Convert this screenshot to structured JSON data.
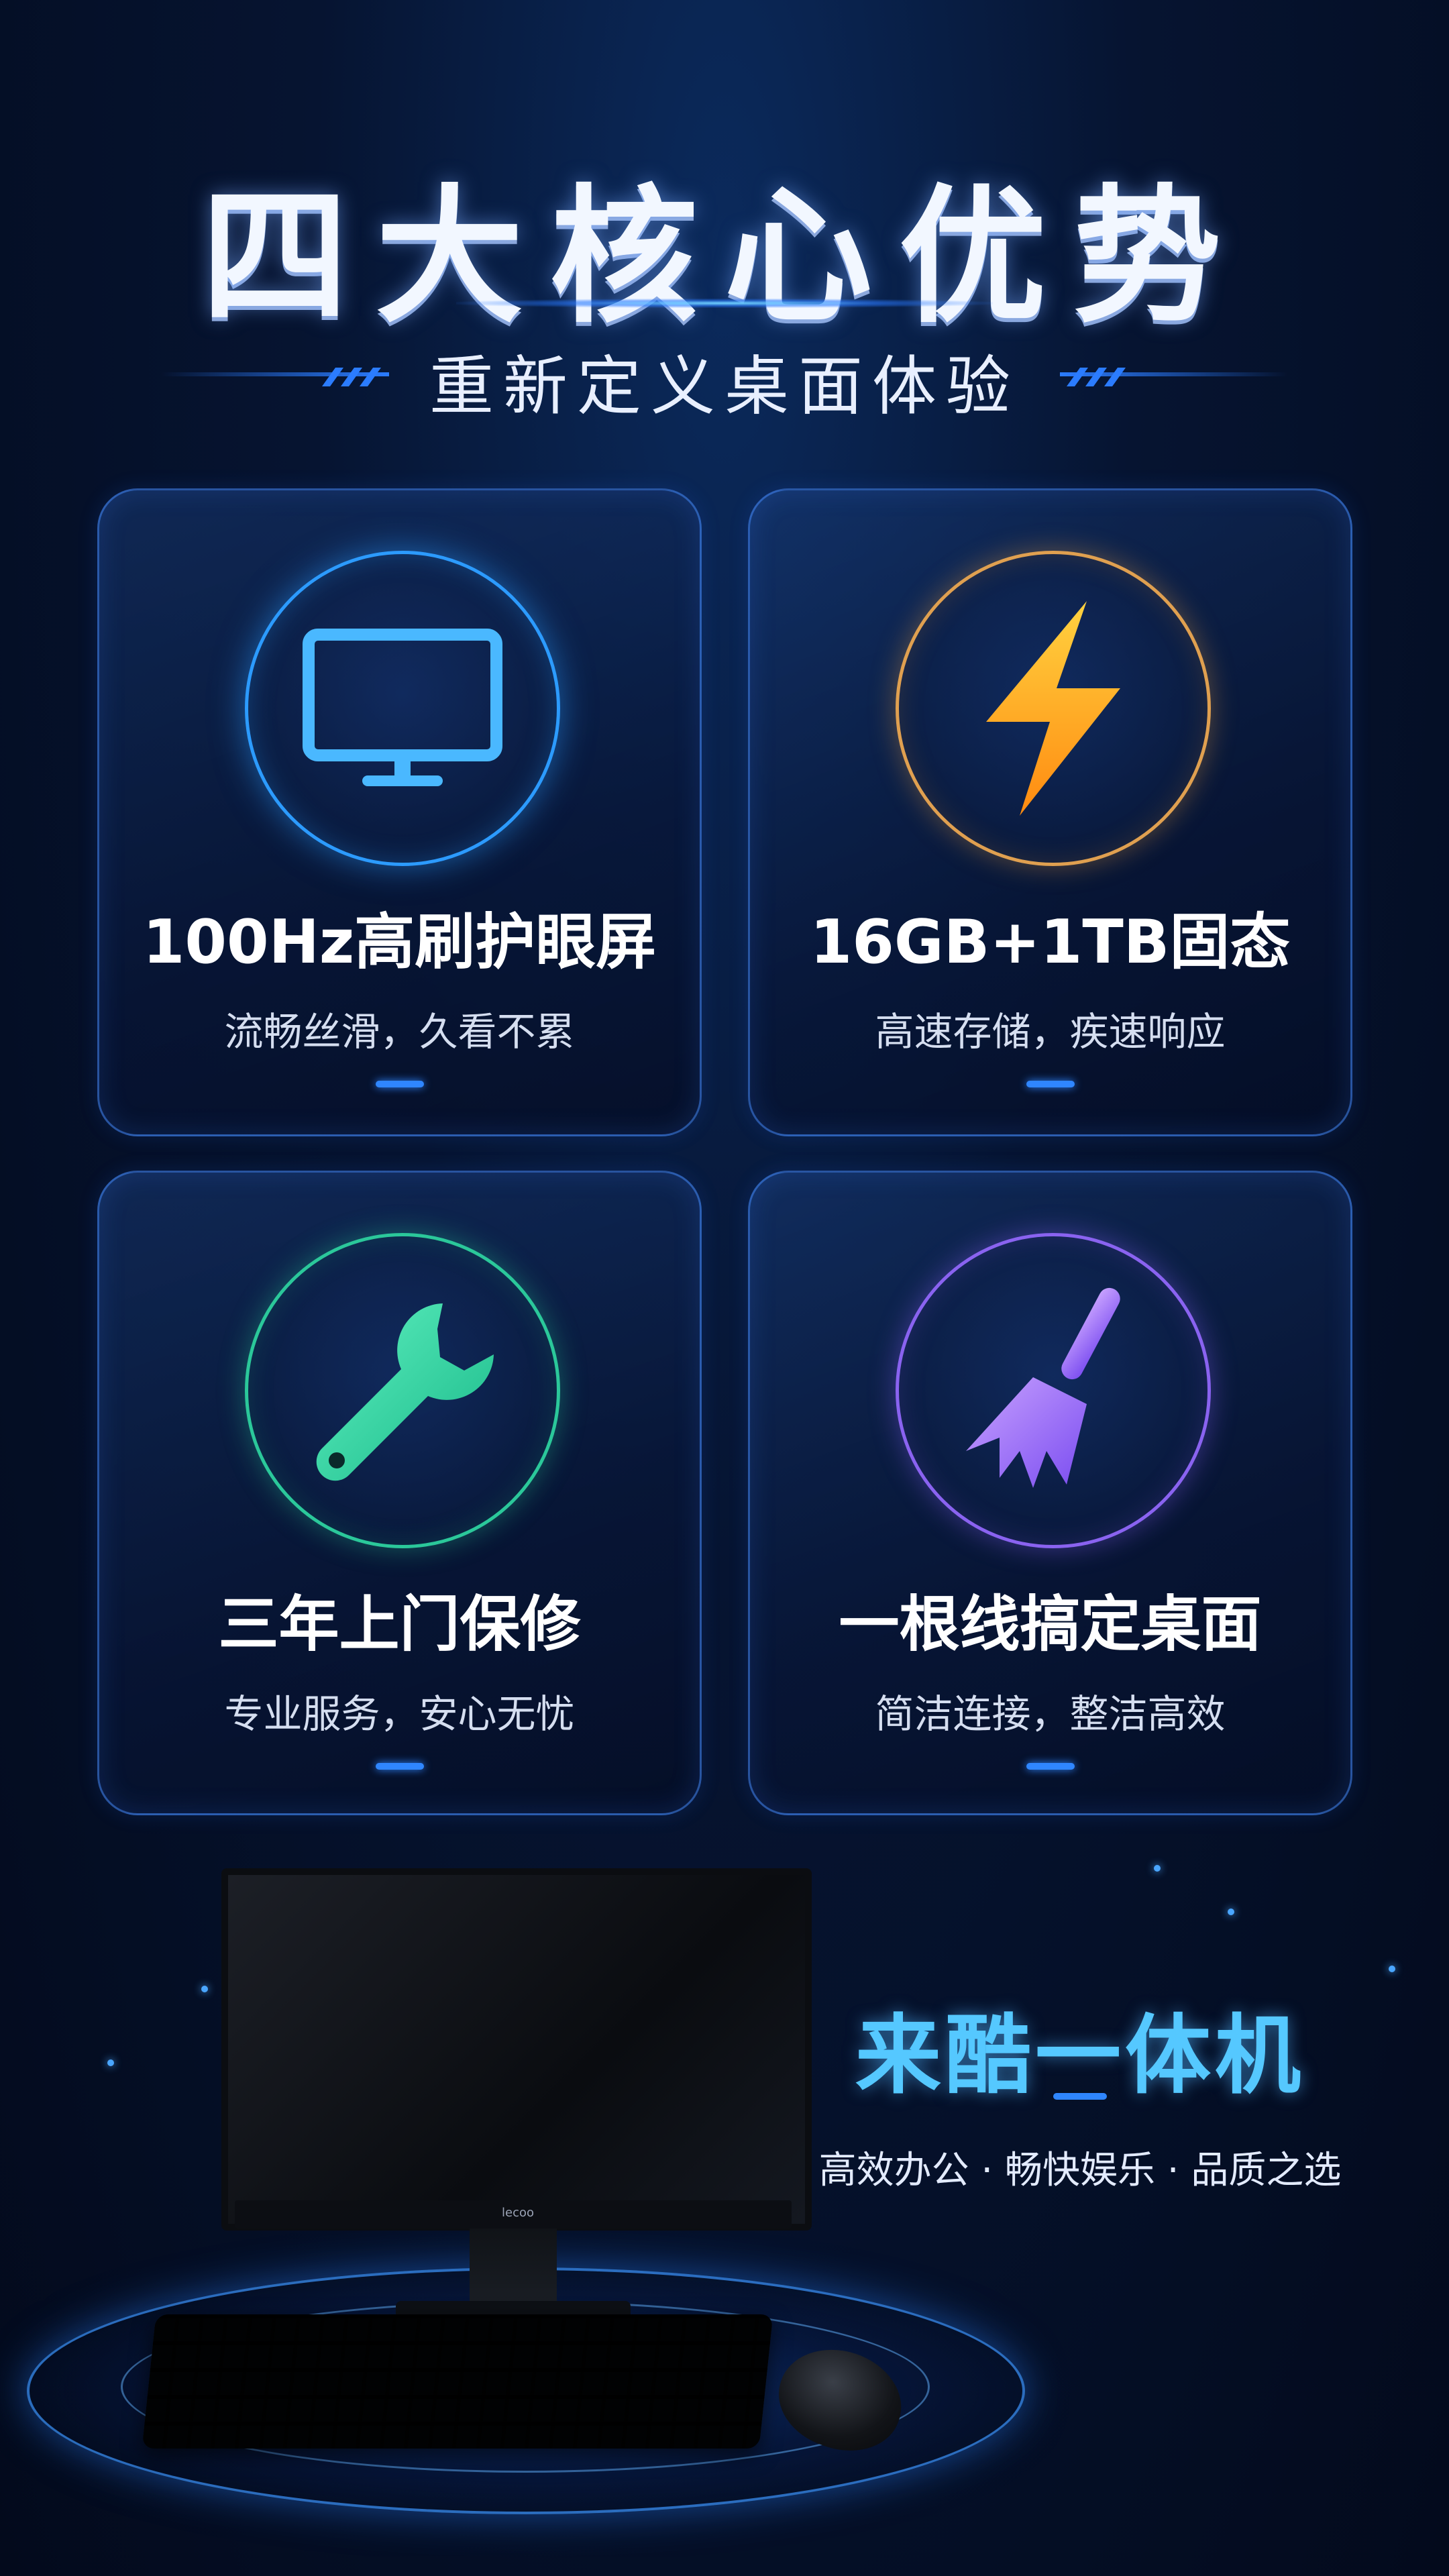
{
  "header": {
    "title": "四大核心优势",
    "subtitle": "重新定义桌面体验"
  },
  "features": [
    {
      "icon": "monitor-icon",
      "title": "100Hz高刷护眼屏",
      "subtitle": "流畅丝滑，久看不累",
      "accent": "#3aa8ff"
    },
    {
      "icon": "lightning-icon",
      "title": "16GB+1TB固态",
      "subtitle": "高速存储，疾速响应",
      "accent": "#ffaa22"
    },
    {
      "icon": "wrench-icon",
      "title": "三年上门保修",
      "subtitle": "专业服务，安心无忧",
      "accent": "#2fe0a8"
    },
    {
      "icon": "broom-icon",
      "title": "一根线搞定桌面",
      "subtitle": "简洁连接，整洁高效",
      "accent": "#9b6bff"
    }
  ],
  "product": {
    "name": "来酷一体机",
    "tagline": "高效办公 · 畅快娱乐 · 品质之选",
    "monitor_logo": "lecoo"
  },
  "colors": {
    "background": "#061431",
    "accent_blue": "#2f86ff",
    "brand_text": "#55c8ff"
  }
}
